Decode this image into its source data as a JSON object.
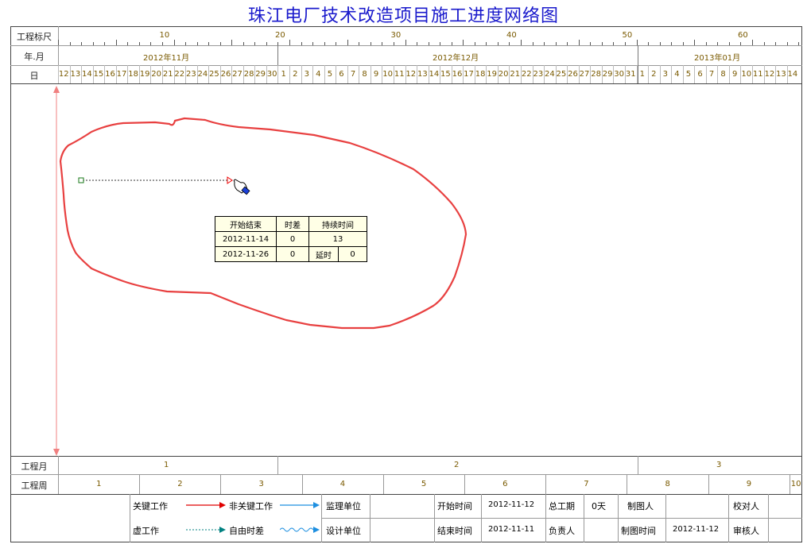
{
  "title": "珠江电厂技术改造项目施工进度网络图",
  "header": {
    "scale_label": "工程标尺",
    "month_label": "年.月",
    "day_label": "日",
    "scale_ticks": [
      "10",
      "20",
      "30",
      "40",
      "50",
      "60"
    ],
    "months": [
      "2012年11月",
      "2012年12月",
      "2013年01月"
    ],
    "days": [
      "12",
      "13",
      "14",
      "15",
      "16",
      "17",
      "18",
      "19",
      "20",
      "21",
      "22",
      "23",
      "24",
      "25",
      "26",
      "27",
      "28",
      "29",
      "30",
      "1",
      "2",
      "3",
      "4",
      "5",
      "6",
      "7",
      "8",
      "9",
      "10",
      "11",
      "12",
      "13",
      "14",
      "15",
      "16",
      "17",
      "18",
      "19",
      "20",
      "21",
      "22",
      "23",
      "24",
      "25",
      "26",
      "27",
      "28",
      "29",
      "30",
      "31",
      "1",
      "2",
      "3",
      "4",
      "5",
      "6",
      "7",
      "8",
      "9",
      "10",
      "11",
      "12",
      "13",
      "14"
    ]
  },
  "info_box": {
    "h_start_end": "开始结束",
    "h_float": "时差",
    "h_duration": "持续时间",
    "start": "2012-11-14",
    "start_float": "0",
    "duration": "13",
    "end": "2012-11-26",
    "end_float": "0",
    "delay_label": "延时",
    "delay": "0"
  },
  "bottom": {
    "project_month_label": "工程月",
    "project_week_label": "工程周",
    "months": [
      "1",
      "2",
      "3"
    ],
    "weeks": [
      "1",
      "2",
      "3",
      "4",
      "5",
      "6",
      "7",
      "8",
      "9",
      "10"
    ]
  },
  "legend": {
    "critical": "关键工作",
    "non_critical": "非关键工作",
    "virtual": "虚工作",
    "free_float": "自由时差",
    "critical_color": "#e00000",
    "non_critical_color": "#1e8fe0",
    "virtual_color": "#008080"
  },
  "footer": {
    "supervisor_label": "监理单位",
    "design_label": "设计单位",
    "start_time_label": "开始时间",
    "start_time": "2012-11-12",
    "end_time_label": "结束时间",
    "end_time": "2012-11-11",
    "total_period_label": "总工期",
    "total_period": "0天",
    "responsible_label": "负责人",
    "drafter_label": "制图人",
    "draw_time_label": "制图时间",
    "draw_time": "2012-11-12",
    "proofreader_label": "校对人",
    "reviewer_label": "审核人"
  }
}
